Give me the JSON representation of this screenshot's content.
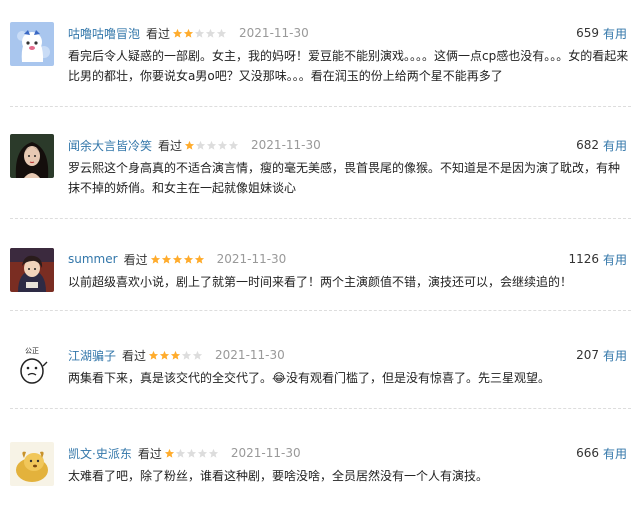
{
  "reviews": [
    {
      "username": "咕噜咕噜冒泡",
      "watched_label": "看过",
      "rating": 2,
      "date": "2021-11-30",
      "votes": "659",
      "useful_label": "有用",
      "content": "看完后令人疑惑的一部剧。女主，我的妈呀！爱豆能不能别演戏。。。。这俩一点cp感也没有。。。女的看起来比男的都壮，你要说女a男o吧？又没那味。。。看在润玉的份上给两个星不能再多了",
      "avatar_icon": "ghost-avatar-icon"
    },
    {
      "username": "闻余大言皆冷笑",
      "watched_label": "看过",
      "rating": 1,
      "date": "2021-11-30",
      "votes": "682",
      "useful_label": "有用",
      "content": "罗云熙这个身高真的不适合演言情，瘦的毫无美感，畏首畏尾的像猴。不知道是不是因为演了耽改，有种抹不掉的娇俏。和女主在一起就像姐妹谈心",
      "avatar_icon": "portrait-avatar-icon"
    },
    {
      "username": "summer",
      "watched_label": "看过",
      "rating": 5,
      "date": "2021-11-30",
      "votes": "1126",
      "useful_label": "有用",
      "content": "以前超级喜欢小说，剧上了就第一时间来看了！两个主演颜值不错，演技还可以，会继续追的！",
      "avatar_icon": "anime-avatar-icon"
    },
    {
      "username": "江湖骗子",
      "watched_label": "看过",
      "rating": 3,
      "date": "2021-11-30",
      "votes": "207",
      "useful_label": "有用",
      "content": "两集看下来，真是该交代的全交代了。😂没有观看门槛了，但是没有惊喜了。先三星观望。",
      "avatar_icon": "doodle-face-avatar-icon",
      "avatar_text": "公正"
    },
    {
      "username": "凯文·史派东",
      "watched_label": "看过",
      "rating": 1,
      "date": "2021-11-30",
      "votes": "666",
      "useful_label": "有用",
      "content": "太难看了吧，除了粉丝，谁看这种剧，要啥没啥，全员居然没有一个人有演技。",
      "avatar_icon": "golden-dog-avatar-icon"
    }
  ],
  "colors": {
    "link": "#3377aa",
    "star_on": "#ffac2d",
    "star_off": "#dddddd",
    "date": "#999999"
  }
}
